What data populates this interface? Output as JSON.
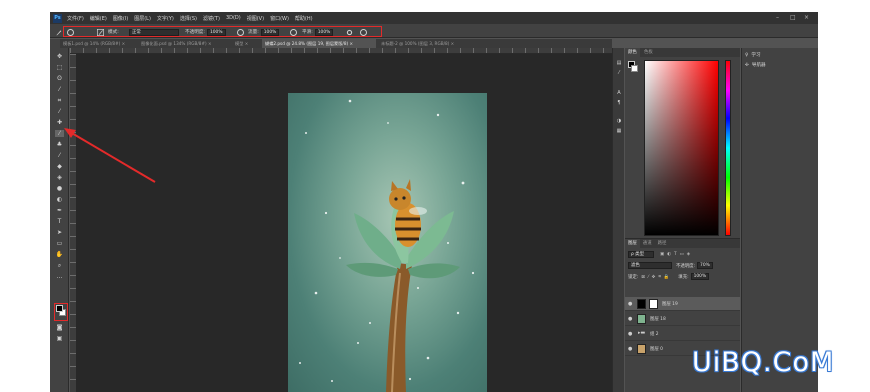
{
  "app": {
    "logo": "Ps"
  },
  "menu": [
    "文件(F)",
    "编辑(E)",
    "图像(I)",
    "图层(L)",
    "文字(Y)",
    "选择(S)",
    "滤镜(T)",
    "3D(D)",
    "视图(V)",
    "窗口(W)",
    "帮助(H)"
  ],
  "window_controls": {
    "minimize": "–",
    "maximize": "□",
    "close": "×"
  },
  "options": {
    "mode_label": "模式:",
    "mode_value": "正常",
    "opacity_label": "不透明度:",
    "opacity_value": "100%",
    "flow_label": "流量:",
    "flow_value": "100%",
    "smoothing_label": "平滑:",
    "smoothing_value": "100%"
  },
  "tabs": [
    "模板1.psd @ 14% (RGB/8#) ×",
    "图像化面.psd @ 134% (RGB/8#) ×",
    "模型 ×",
    "蝴蝶2.psd @ 24.8% (图层 19, 图层蒙版/8) ×",
    "未标题-2 @ 100% (图层 3, RGB/8) ×"
  ],
  "color_panel": {
    "tabs": [
      "颜色",
      "色板"
    ]
  },
  "layers_panel": {
    "tabs": [
      "图层",
      "通道",
      "路径"
    ],
    "kind_label": "ρ 类型",
    "blend_mode": "滤色",
    "opacity_label": "不透明度:",
    "opacity_value": "70%",
    "lock_label": "锁定:",
    "fill_label": "填充:",
    "fill_value": "100%",
    "layers": [
      {
        "name": "图层 19"
      },
      {
        "name": "图层 18"
      },
      {
        "name": "组 2"
      },
      {
        "name": "图层 0"
      }
    ]
  },
  "side_panel": {
    "items": [
      "学习",
      "导航器"
    ]
  },
  "watermark": "UiBQ.CoM",
  "colors": {
    "accent_red": "#e32a2a",
    "panel": "#424242",
    "canvas_bg": "#282828"
  }
}
